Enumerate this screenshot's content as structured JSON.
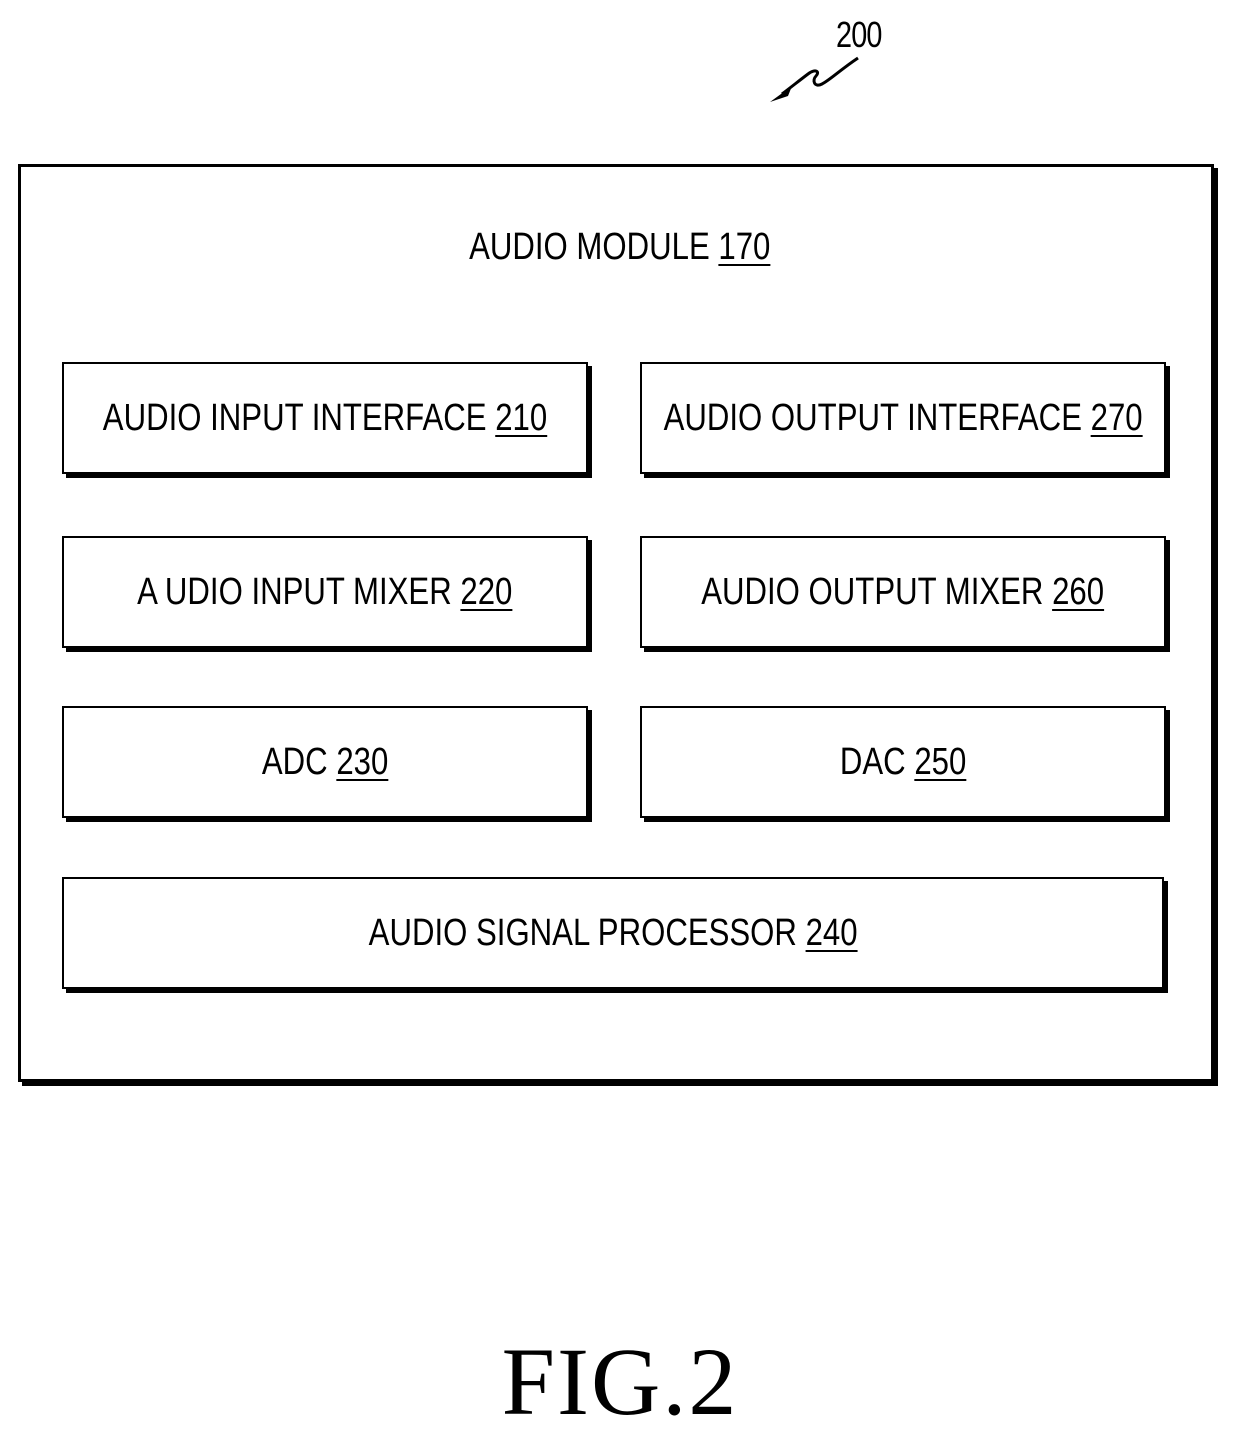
{
  "figure": {
    "reference_number": "200",
    "caption": "FIG.2"
  },
  "module": {
    "name": "AUDIO MODULE",
    "number": "170"
  },
  "blocks": [
    {
      "name": "AUDIO INPUT INTERFACE",
      "number": "210"
    },
    {
      "name": "AUDIO OUTPUT INTERFACE",
      "number": "270"
    },
    {
      "name": "A UDIO INPUT MIXER",
      "number": "220"
    },
    {
      "name": "AUDIO OUTPUT MIXER",
      "number": "260"
    },
    {
      "name": "ADC",
      "number": "230"
    },
    {
      "name": "DAC",
      "number": "250"
    },
    {
      "name": "AUDIO SIGNAL PROCESSOR",
      "number": "240"
    }
  ]
}
